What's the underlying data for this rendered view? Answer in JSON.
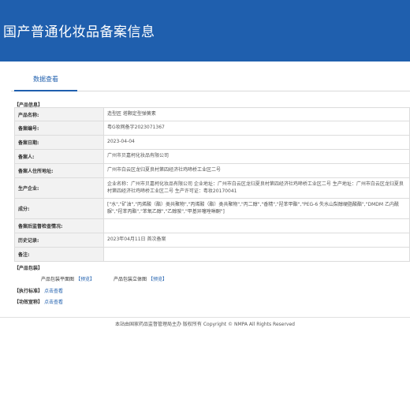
{
  "header": {
    "title": "国产普通化妆品备案信息"
  },
  "tabs": [
    {
      "label": "数据查看"
    }
  ],
  "product_info": {
    "section_label": "【产品信息】",
    "rows": [
      {
        "label": "产品名称:",
        "value": "造型匠 塔颗定型弹簧素"
      },
      {
        "label": "备案编号:",
        "value": "粤G妆网备字2023071367"
      },
      {
        "label": "备案日期:",
        "value": "2023-04-04"
      },
      {
        "label": "备案人:",
        "value": "广州市贝嘉柯化妆品有限公司"
      },
      {
        "label": "备案人住所地址:",
        "value": "广州市白云区龙归夏良村第四经济社鸡啼桥工业区二号"
      },
      {
        "label": "生产企业:",
        "value": "企业名称：广州市贝嘉柯化妆品有限公司 企业地址：广州市白云区龙归夏良村第四经济社鸡啼桥工业区二号 生产地址：广州市白云区龙归夏良村第四经济社鸡啼桥工业区二号 生产许可证：粤妆20170041"
      },
      {
        "label": "成分:",
        "value": "[\"水\",\"矿油\",\"丙烯酸（酯）类共聚物\",\"丙烯酸（酯）类共聚物\",\"丙二醇\",\"香精\",\"羟苯甲酯\",\"PEG-6 失水山梨醇硬脂酸酯\",\"DMDM 乙内酰脲\",\"羟苯丙酯\",\"苯氧乙醇\",\"乙醇胺\",\"甲基异噻唑啉酮\"]"
      },
      {
        "label": "备案后监督检查情况:",
        "value": ""
      },
      {
        "label": "历史记录:",
        "value": "2023年04月11日 首次备案"
      },
      {
        "label": "备注:",
        "value": ""
      }
    ]
  },
  "packaging": {
    "section_label": "【产品包装】",
    "flat_label": "产品包装平面图",
    "flat_link": "【预览】",
    "solid_label": "产品包装立体图",
    "solid_link": "【预览】"
  },
  "standard": {
    "label": "【执行标准】",
    "link": "点击查看"
  },
  "efficacy": {
    "label": "【功效宣称】",
    "link": "点击查看"
  },
  "footer": {
    "text": "本站由国家药品监督管理局主办 版权所有 Copyright © NMPA All Rights Reserved"
  },
  "colors": {
    "banner": "#1f5fae",
    "link": "#1f5fae",
    "label_bg": "#f2f2f2"
  }
}
